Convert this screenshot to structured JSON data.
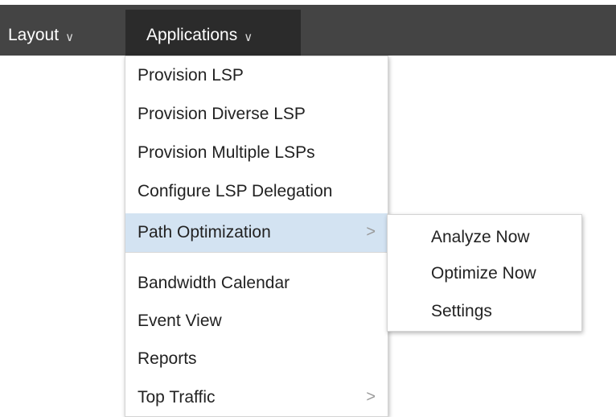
{
  "menubar": {
    "layout": {
      "label": "Layout",
      "icon": "chevron-down-icon"
    },
    "applications": {
      "label": "Applications",
      "icon": "chevron-down-icon"
    },
    "colors": {
      "bar": "#444444",
      "active": "#2b2b2b",
      "text": "#ffffff"
    }
  },
  "applications_menu": {
    "items": [
      {
        "label": "Provision LSP"
      },
      {
        "label": "Provision Diverse LSP"
      },
      {
        "label": "Provision Multiple LSPs"
      },
      {
        "label": "Configure LSP Delegation"
      },
      {
        "label": "Path Optimization",
        "submenu": true,
        "highlighted": true,
        "icon": "chevron-right-icon"
      },
      {
        "label": "Bandwidth Calendar"
      },
      {
        "label": "Event View"
      },
      {
        "label": "Reports"
      },
      {
        "label": "Top Traffic",
        "submenu": true,
        "icon": "chevron-right-icon"
      }
    ],
    "colors": {
      "highlight": "#d3e3f2",
      "text": "#222222"
    }
  },
  "path_optimization_submenu": {
    "items": [
      {
        "label": "Analyze Now"
      },
      {
        "label": "Optimize Now"
      },
      {
        "label": "Settings"
      }
    ]
  }
}
